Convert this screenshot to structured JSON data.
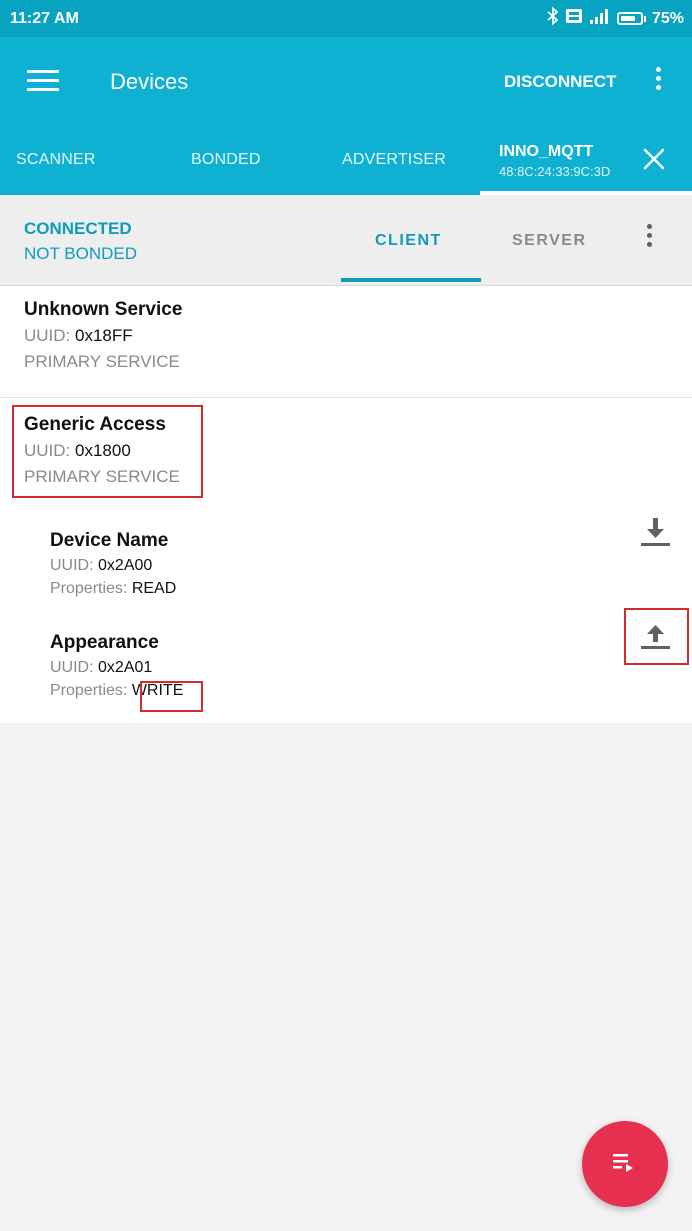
{
  "status_bar": {
    "time": "11:27 AM",
    "battery_percent_label": "75%",
    "battery_level": 0.75,
    "icons": [
      "bluetooth-icon",
      "volte-icon",
      "signal-icon",
      "battery-icon"
    ]
  },
  "app_bar": {
    "title": "Devices",
    "disconnect_label": "DISCONNECT",
    "menu_icon": "hamburger-menu-icon",
    "overflow_icon": "more-vert-icon"
  },
  "tabs": {
    "scanner": "SCANNER",
    "bonded": "BONDED",
    "advertiser": "ADVERTISER",
    "device": {
      "name": "INNO_MQTT",
      "address": "48:8C:24:33:9C:3D",
      "close_icon": "close-icon"
    }
  },
  "connection": {
    "state": "CONNECTED",
    "bond_state": "NOT BONDED"
  },
  "subtabs": {
    "client": "CLIENT",
    "server": "SERVER"
  },
  "uuid_label": "UUID:",
  "properties_label": "Properties:",
  "services": [
    {
      "title": "Unknown Service",
      "uuid": "0x18FF",
      "type": "PRIMARY SERVICE"
    },
    {
      "title": "Generic Access",
      "uuid": "0x1800",
      "type": "PRIMARY SERVICE",
      "characteristics": [
        {
          "title": "Device Name",
          "uuid": "0x2A00",
          "properties": "READ",
          "action_icon": "download-icon"
        },
        {
          "title": "Appearance",
          "uuid": "0x2A01",
          "properties": "WRITE",
          "action_icon": "upload-icon"
        }
      ]
    }
  ],
  "colors": {
    "status_bar": "#07a3c1",
    "app_bar": "#0eb1d2",
    "accent": "#0e9cbc",
    "highlight_box": "#d22b2b",
    "fab": "#e6304f"
  },
  "fab_icon": "playlist-play-icon"
}
